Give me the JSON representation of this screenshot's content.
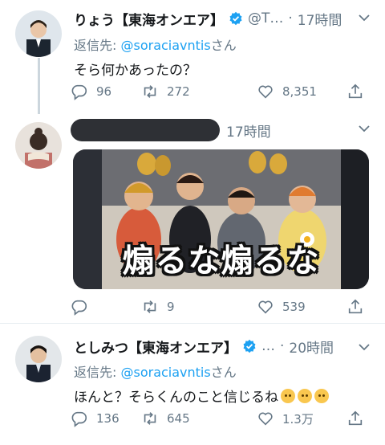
{
  "tweets": [
    {
      "name": "りょう【東海オンエア】",
      "handle": "@T…",
      "time": "17時間",
      "replying_label": "返信先: ",
      "replying_mention": "@soraciavntis",
      "replying_suffix": "さん",
      "text": "そら何かあったの？",
      "replies": "96",
      "retweets": "272",
      "likes": "8,351"
    },
    {
      "name_redacted": true,
      "time": "17時間",
      "media_caption": "煽るな煽るな",
      "replies": "",
      "retweets": "9",
      "likes": "539"
    },
    {
      "name": "としみつ【東海オンエア】",
      "handle": "…",
      "time": "20時間",
      "replying_label": "返信先: ",
      "replying_mention": "@soraciavntis",
      "replying_suffix": "さん",
      "text": "ほんと？そらくんのこと信じるね",
      "replies": "136",
      "retweets": "645",
      "likes": "1.3万"
    }
  ],
  "colors": {
    "accent": "#1da1f2",
    "secondary_text": "#657786",
    "divider": "#e6ecf0"
  },
  "icons": [
    "reply-icon",
    "retweet-icon",
    "like-icon",
    "share-icon",
    "verified-badge-icon",
    "chevron-down-icon"
  ]
}
